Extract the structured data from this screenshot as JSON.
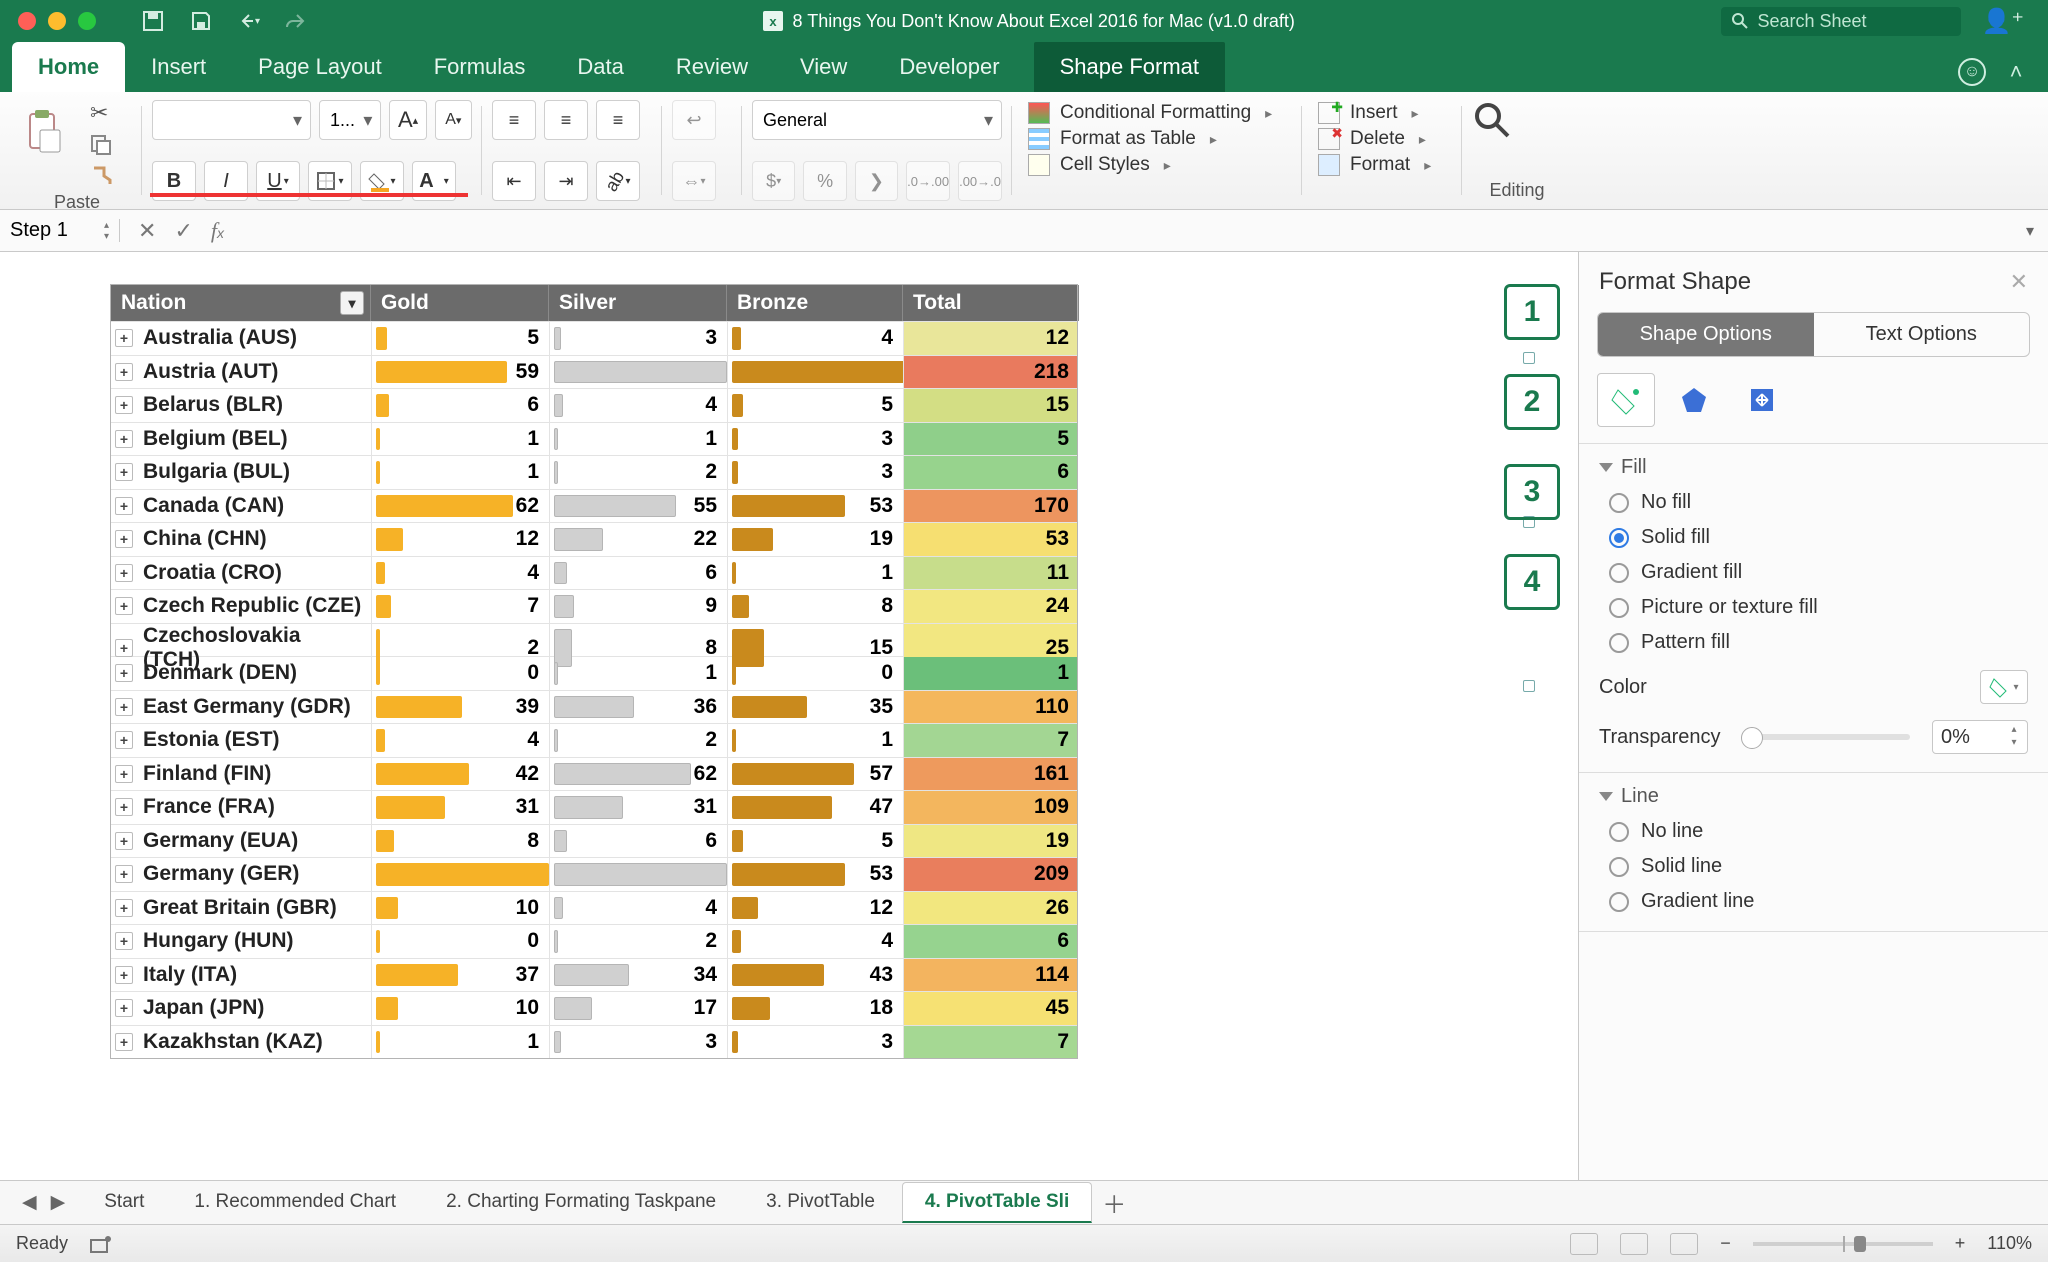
{
  "window": {
    "title": "8 Things You Don't Know About Excel 2016 for Mac (v1.0 draft)",
    "search_placeholder": "Search Sheet"
  },
  "tabs": {
    "items": [
      "Home",
      "Insert",
      "Page Layout",
      "Formulas",
      "Data",
      "Review",
      "View",
      "Developer",
      "Shape Format"
    ],
    "active": "Home",
    "contextual": "Shape Format"
  },
  "ribbon": {
    "paste_label": "Paste",
    "font_size": "1...",
    "number_format": "General",
    "styles": {
      "cond": "Conditional Formatting",
      "table": "Format as Table",
      "cell": "Cell Styles"
    },
    "cells": {
      "insert": "Insert",
      "delete": "Delete",
      "format": "Format"
    },
    "editing_label": "Editing"
  },
  "formula_bar": {
    "namebox": "Step 1"
  },
  "format_pane": {
    "title": "Format Shape",
    "tabs": [
      "Shape Options",
      "Text Options"
    ],
    "active_tab": "Shape Options",
    "fill_label": "Fill",
    "fill_options": [
      "No fill",
      "Solid fill",
      "Gradient fill",
      "Picture or texture fill",
      "Pattern fill"
    ],
    "fill_selected": "Solid fill",
    "color_label": "Color",
    "transparency_label": "Transparency",
    "transparency_value": "0%",
    "line_label": "Line",
    "line_options": [
      "No line",
      "Solid line",
      "Gradient line"
    ]
  },
  "step_shapes": [
    "1",
    "2",
    "3",
    "4"
  ],
  "pivot": {
    "headers": [
      "Nation",
      "Gold",
      "Silver",
      "Bronze",
      "Total"
    ],
    "max": {
      "gold": 80,
      "silver": 80,
      "bronze": 82,
      "total": 220
    },
    "rows": [
      {
        "nation": "Australia (AUS)",
        "gold": 5,
        "silver": 3,
        "bronze": 4,
        "total": 12,
        "tcolor": "#e9e69a"
      },
      {
        "nation": "Austria (AUT)",
        "gold": 59,
        "silver": 78,
        "bronze": 81,
        "total": 218,
        "tcolor": "#e97a5e"
      },
      {
        "nation": "Belarus (BLR)",
        "gold": 6,
        "silver": 4,
        "bronze": 5,
        "total": 15,
        "tcolor": "#d3de84"
      },
      {
        "nation": "Belgium (BEL)",
        "gold": 1,
        "silver": 1,
        "bronze": 3,
        "total": 5,
        "tcolor": "#8fcf8a"
      },
      {
        "nation": "Bulgaria (BUL)",
        "gold": 1,
        "silver": 2,
        "bronze": 3,
        "total": 6,
        "tcolor": "#97d38d"
      },
      {
        "nation": "Canada (CAN)",
        "gold": 62,
        "silver": 55,
        "bronze": 53,
        "total": 170,
        "tcolor": "#ed955f"
      },
      {
        "nation": "China (CHN)",
        "gold": 12,
        "silver": 22,
        "bronze": 19,
        "total": 53,
        "tcolor": "#f6df71"
      },
      {
        "nation": "Croatia (CRO)",
        "gold": 4,
        "silver": 6,
        "bronze": 1,
        "total": 11,
        "tcolor": "#c7dd8b"
      },
      {
        "nation": "Czech Republic (CZE)",
        "gold": 7,
        "silver": 9,
        "bronze": 8,
        "total": 24,
        "tcolor": "#f2e781"
      },
      {
        "nation": "Czechoslovakia (TCH)",
        "gold": 2,
        "silver": 8,
        "bronze": 15,
        "total": 25,
        "tcolor": "#f2e781"
      },
      {
        "nation": "Denmark (DEN)",
        "gold": 0,
        "silver": 1,
        "bronze": 0,
        "total": 1,
        "tcolor": "#6bbf7a"
      },
      {
        "nation": "East Germany (GDR)",
        "gold": 39,
        "silver": 36,
        "bronze": 35,
        "total": 110,
        "tcolor": "#f4b75c"
      },
      {
        "nation": "Estonia (EST)",
        "gold": 4,
        "silver": 2,
        "bronze": 1,
        "total": 7,
        "tcolor": "#a3d693"
      },
      {
        "nation": "Finland (FIN)",
        "gold": 42,
        "silver": 62,
        "bronze": 57,
        "total": 161,
        "tcolor": "#ee9a5d"
      },
      {
        "nation": "France (FRA)",
        "gold": 31,
        "silver": 31,
        "bronze": 47,
        "total": 109,
        "tcolor": "#f3b65e"
      },
      {
        "nation": "Germany (EUA)",
        "gold": 8,
        "silver": 6,
        "bronze": 5,
        "total": 19,
        "tcolor": "#efe783"
      },
      {
        "nation": "Germany (GER)",
        "gold": 78,
        "silver": 78,
        "bronze": 53,
        "total": 209,
        "tcolor": "#e97e5d"
      },
      {
        "nation": "Great Britain (GBR)",
        "gold": 10,
        "silver": 4,
        "bronze": 12,
        "total": 26,
        "tcolor": "#f2e77f"
      },
      {
        "nation": "Hungary (HUN)",
        "gold": 0,
        "silver": 2,
        "bronze": 4,
        "total": 6,
        "tcolor": "#96d38f"
      },
      {
        "nation": "Italy (ITA)",
        "gold": 37,
        "silver": 34,
        "bronze": 43,
        "total": 114,
        "tcolor": "#f3b45f"
      },
      {
        "nation": "Japan (JPN)",
        "gold": 10,
        "silver": 17,
        "bronze": 18,
        "total": 45,
        "tcolor": "#f6e173"
      },
      {
        "nation": "Kazakhstan (KAZ)",
        "gold": 1,
        "silver": 3,
        "bronze": 3,
        "total": 7,
        "tcolor": "#a5d893"
      }
    ]
  },
  "sheet_tabs": {
    "items": [
      "Start",
      "1. Recommended Chart",
      "2. Charting Formating Taskpane",
      "3. PivotTable",
      "4. PivotTable Sli"
    ],
    "active": "4. PivotTable Sli"
  },
  "status_bar": {
    "ready": "Ready",
    "zoom": "110%"
  }
}
